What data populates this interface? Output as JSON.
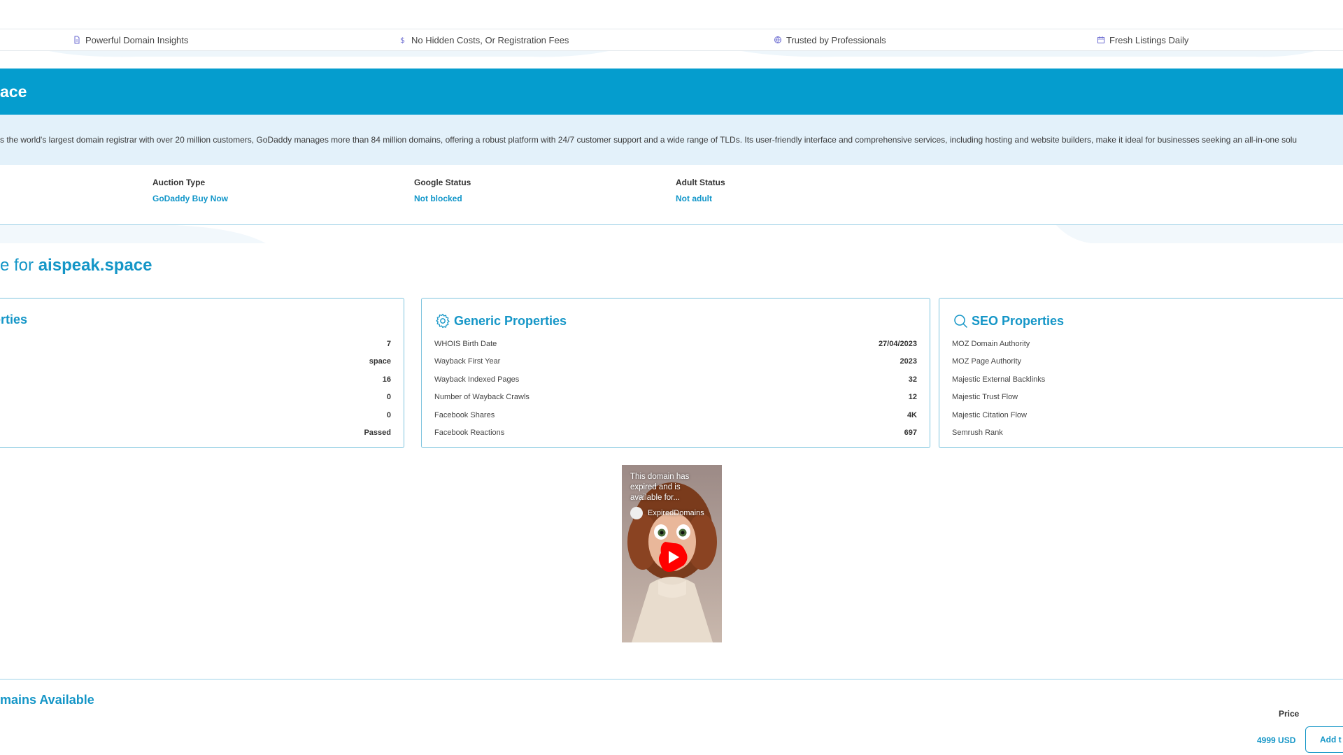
{
  "features": [
    {
      "icon": "document-icon",
      "label": "Powerful Domain Insights"
    },
    {
      "icon": "dollar-icon",
      "label": "No Hidden Costs, Or Registration Fees"
    },
    {
      "icon": "globe-icon",
      "label": "Trusted by Professionals"
    },
    {
      "icon": "calendar-icon",
      "label": "Fresh Listings Daily"
    }
  ],
  "banner": {
    "title": "ace",
    "description": "s the world's largest domain registrar with over 20 million customers, GoDaddy manages more than 84 million domains, offering a robust platform with 24/7 customer support and a wide range of TLDs. Its user-friendly interface and comprehensive services, including hosting and website builders, make it ideal for businesses seeking an all-in-one solu"
  },
  "status": {
    "auction_type": {
      "label": "Auction Type",
      "value": "GoDaddy Buy Now"
    },
    "google_status": {
      "label": "Google Status",
      "value": "Not blocked"
    },
    "adult_status": {
      "label": "Adult Status",
      "value": "Not adult"
    }
  },
  "heading": {
    "prefix": "e for ",
    "domain": "aispeak.space"
  },
  "cards": {
    "left": {
      "title": "erties",
      "rows": [
        {
          "label": "",
          "value": "7"
        },
        {
          "label": "",
          "value": "space"
        },
        {
          "label": "",
          "value": "16"
        },
        {
          "label": "",
          "value": "0"
        },
        {
          "label": "",
          "value": "0"
        },
        {
          "label": "",
          "value": "Passed"
        }
      ]
    },
    "generic": {
      "title": "Generic Properties",
      "icon": "gear-icon",
      "rows": [
        {
          "label": "WHOIS Birth Date",
          "value": "27/04/2023"
        },
        {
          "label": "Wayback First Year",
          "value": "2023"
        },
        {
          "label": "Wayback Indexed Pages",
          "value": "32"
        },
        {
          "label": "Number of Wayback Crawls",
          "value": "12"
        },
        {
          "label": "Facebook Shares",
          "value": "4K"
        },
        {
          "label": "Facebook Reactions",
          "value": "697"
        }
      ]
    },
    "seo": {
      "title": "SEO Properties",
      "icon": "search-icon",
      "rows": [
        {
          "label": "MOZ Domain Authority",
          "value": ""
        },
        {
          "label": "MOZ Page Authority",
          "value": ""
        },
        {
          "label": "Majestic External Backlinks",
          "value": ""
        },
        {
          "label": "Majestic Trust Flow",
          "value": ""
        },
        {
          "label": "Majestic Citation Flow",
          "value": ""
        },
        {
          "label": "Semrush Rank",
          "value": ""
        }
      ]
    }
  },
  "video": {
    "caption": "This domain has expired and is available for...",
    "channel": "ExpiredDomains",
    "play_icon": "play-icon"
  },
  "lower": {
    "heading": "mains Available",
    "price_header": "Price",
    "price_value": "4999 USD",
    "add_button": "Add t"
  },
  "colors": {
    "accent": "#059dce",
    "link": "#1596c7",
    "description_bg": "#e3f1fa",
    "play_red": "#ff0000"
  }
}
